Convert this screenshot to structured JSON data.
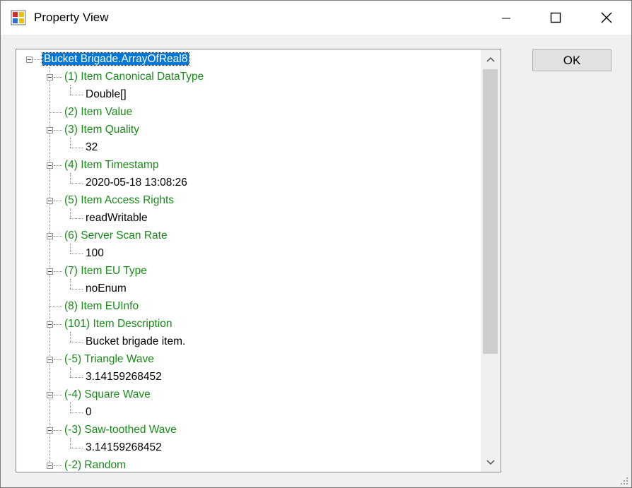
{
  "window": {
    "title": "Property View"
  },
  "buttons": {
    "ok_label": "OK"
  },
  "tree": {
    "root": "Bucket Brigade.ArrayOfReal8",
    "items": [
      {
        "label": "(1) Item Canonical DataType",
        "value": "Double[]"
      },
      {
        "label": "(2) Item Value"
      },
      {
        "label": "(3) Item Quality",
        "value": "32"
      },
      {
        "label": "(4) Item Timestamp",
        "value": "2020-05-18 13:08:26"
      },
      {
        "label": "(5) Item Access Rights",
        "value": "readWritable"
      },
      {
        "label": "(6) Server Scan Rate",
        "value": "100"
      },
      {
        "label": "(7) Item EU Type",
        "value": "noEnum"
      },
      {
        "label": "(8) Item EUInfo"
      },
      {
        "label": "(101) Item Description",
        "value": "Bucket brigade item."
      },
      {
        "label": "(-5) Triangle Wave",
        "value": "3.14159268452"
      },
      {
        "label": "(-4) Square Wave",
        "value": "0"
      },
      {
        "label": "(-3) Saw-toothed Wave",
        "value": "3.14159268452"
      },
      {
        "label": "(-2) Random"
      }
    ]
  },
  "colors": {
    "property": "#1a8a1a",
    "selection": "#0078d7"
  }
}
